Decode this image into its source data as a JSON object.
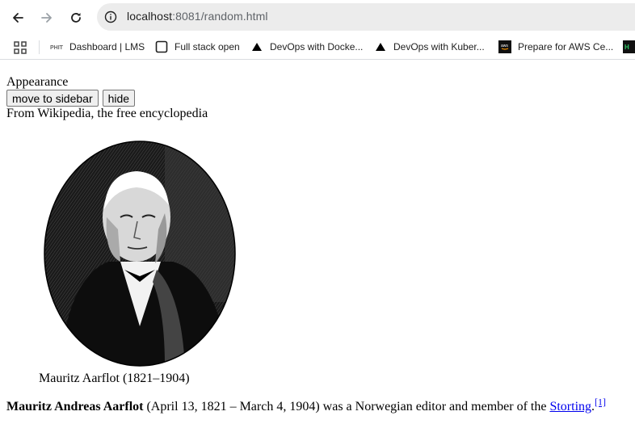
{
  "browser": {
    "url_host": "localhost",
    "url_rest": ":8081/random.html"
  },
  "bookmarks": [
    {
      "label": "Dashboard | LMS",
      "icon": "phit-logo-icon"
    },
    {
      "label": "Full stack open",
      "icon": "square-outline-icon"
    },
    {
      "label": "DevOps with Docke...",
      "icon": "triangle-icon"
    },
    {
      "label": "DevOps with Kuber...",
      "icon": "triangle-icon"
    },
    {
      "label": "Prepare for AWS Ce...",
      "icon": "aws-logo-icon"
    }
  ],
  "page": {
    "appearance": "Appearance",
    "move_button": "move to sidebar",
    "hide_button": "hide",
    "tagline": "From Wikipedia, the free encyclopedia",
    "caption": "Mauritz Aarflot (1821–1904)",
    "para_bold": "Mauritz Andreas Aarflot",
    "para_text": " (April 13, 1821 – March 4, 1904) was a Norwegian editor and member of the ",
    "para_link": "Storting",
    "para_end": ".",
    "para_ref": "[1]"
  }
}
